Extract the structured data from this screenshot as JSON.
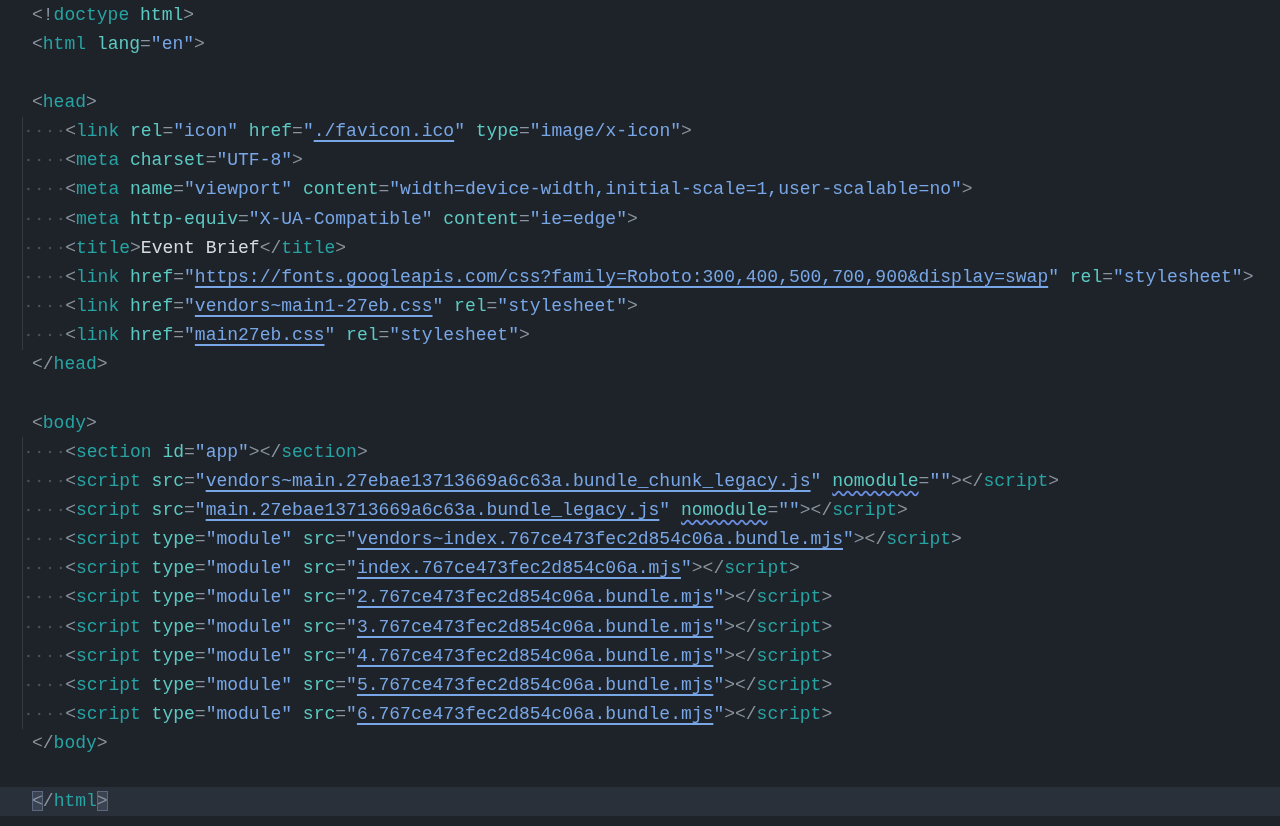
{
  "lines": [
    {
      "kind": "code",
      "indented": false,
      "current": false,
      "tokens": [
        {
          "kind": "p",
          "text": "<!"
        },
        {
          "kind": "tag",
          "text": "doctype"
        },
        {
          "kind": "attr",
          "text": " html"
        },
        {
          "kind": "p",
          "text": ">"
        }
      ]
    },
    {
      "kind": "code",
      "indented": false,
      "current": false,
      "tokens": [
        {
          "kind": "p",
          "text": "<"
        },
        {
          "kind": "tag",
          "text": "html"
        },
        {
          "kind": "attr",
          "text": " lang"
        },
        {
          "kind": "p",
          "text": "="
        },
        {
          "kind": "str",
          "text": "\"en\""
        },
        {
          "kind": "p",
          "text": ">"
        }
      ]
    },
    {
      "kind": "blank"
    },
    {
      "kind": "code",
      "indented": false,
      "current": false,
      "tokens": [
        {
          "kind": "p",
          "text": "<"
        },
        {
          "kind": "tag",
          "text": "head"
        },
        {
          "kind": "p",
          "text": ">"
        }
      ]
    },
    {
      "kind": "code",
      "indented": true,
      "current": false,
      "tokens": [
        {
          "kind": "p",
          "text": "<"
        },
        {
          "kind": "tag",
          "text": "link"
        },
        {
          "kind": "attr",
          "text": " rel"
        },
        {
          "kind": "p",
          "text": "="
        },
        {
          "kind": "str",
          "text": "\"icon\""
        },
        {
          "kind": "attr",
          "text": " href"
        },
        {
          "kind": "p",
          "text": "="
        },
        {
          "kind": "str",
          "text": "\""
        },
        {
          "kind": "link",
          "text": "./favicon.ico"
        },
        {
          "kind": "str",
          "text": "\""
        },
        {
          "kind": "attr",
          "text": " type"
        },
        {
          "kind": "p",
          "text": "="
        },
        {
          "kind": "str",
          "text": "\"image/x-icon\""
        },
        {
          "kind": "p",
          "text": ">"
        }
      ]
    },
    {
      "kind": "code",
      "indented": true,
      "current": false,
      "tokens": [
        {
          "kind": "p",
          "text": "<"
        },
        {
          "kind": "tag",
          "text": "meta"
        },
        {
          "kind": "attr",
          "text": " charset"
        },
        {
          "kind": "p",
          "text": "="
        },
        {
          "kind": "str",
          "text": "\"UTF-8\""
        },
        {
          "kind": "p",
          "text": ">"
        }
      ]
    },
    {
      "kind": "code",
      "indented": true,
      "current": false,
      "tokens": [
        {
          "kind": "p",
          "text": "<"
        },
        {
          "kind": "tag",
          "text": "meta"
        },
        {
          "kind": "attr",
          "text": " name"
        },
        {
          "kind": "p",
          "text": "="
        },
        {
          "kind": "str",
          "text": "\"viewport\""
        },
        {
          "kind": "attr",
          "text": " content"
        },
        {
          "kind": "p",
          "text": "="
        },
        {
          "kind": "str",
          "text": "\"width=device-width,initial-scale=1,user-scalable=no\""
        },
        {
          "kind": "p",
          "text": ">"
        }
      ]
    },
    {
      "kind": "code",
      "indented": true,
      "current": false,
      "tokens": [
        {
          "kind": "p",
          "text": "<"
        },
        {
          "kind": "tag",
          "text": "meta"
        },
        {
          "kind": "attr",
          "text": " http-equiv"
        },
        {
          "kind": "p",
          "text": "="
        },
        {
          "kind": "str",
          "text": "\"X-UA-Compatible\""
        },
        {
          "kind": "attr",
          "text": " content"
        },
        {
          "kind": "p",
          "text": "="
        },
        {
          "kind": "str",
          "text": "\"ie=edge\""
        },
        {
          "kind": "p",
          "text": ">"
        }
      ]
    },
    {
      "kind": "code",
      "indented": true,
      "current": false,
      "tokens": [
        {
          "kind": "p",
          "text": "<"
        },
        {
          "kind": "tag",
          "text": "title"
        },
        {
          "kind": "p",
          "text": ">"
        },
        {
          "kind": "text",
          "text": "Event Brief"
        },
        {
          "kind": "p",
          "text": "</"
        },
        {
          "kind": "tag",
          "text": "title"
        },
        {
          "kind": "p",
          "text": ">"
        }
      ]
    },
    {
      "kind": "code",
      "indented": true,
      "current": false,
      "tokens": [
        {
          "kind": "p",
          "text": "<"
        },
        {
          "kind": "tag",
          "text": "link"
        },
        {
          "kind": "attr",
          "text": " href"
        },
        {
          "kind": "p",
          "text": "="
        },
        {
          "kind": "str",
          "text": "\""
        },
        {
          "kind": "link",
          "text": "https://fonts.googleapis.com/css?family=Roboto:300,400,500,700,900&display=swap"
        },
        {
          "kind": "str",
          "text": "\""
        },
        {
          "kind": "attr",
          "text": " rel"
        },
        {
          "kind": "p",
          "text": "="
        },
        {
          "kind": "str",
          "text": "\"stylesheet\""
        },
        {
          "kind": "p",
          "text": ">"
        }
      ]
    },
    {
      "kind": "code",
      "indented": true,
      "current": false,
      "tokens": [
        {
          "kind": "p",
          "text": "<"
        },
        {
          "kind": "tag",
          "text": "link"
        },
        {
          "kind": "attr",
          "text": " href"
        },
        {
          "kind": "p",
          "text": "="
        },
        {
          "kind": "str",
          "text": "\""
        },
        {
          "kind": "link",
          "text": "vendors~main1-27eb.css"
        },
        {
          "kind": "str",
          "text": "\""
        },
        {
          "kind": "attr",
          "text": " rel"
        },
        {
          "kind": "p",
          "text": "="
        },
        {
          "kind": "str",
          "text": "\"stylesheet\""
        },
        {
          "kind": "p",
          "text": ">"
        }
      ]
    },
    {
      "kind": "code",
      "indented": true,
      "current": false,
      "tokens": [
        {
          "kind": "p",
          "text": "<"
        },
        {
          "kind": "tag",
          "text": "link"
        },
        {
          "kind": "attr",
          "text": " href"
        },
        {
          "kind": "p",
          "text": "="
        },
        {
          "kind": "str",
          "text": "\""
        },
        {
          "kind": "link",
          "text": "main27eb.css"
        },
        {
          "kind": "str",
          "text": "\""
        },
        {
          "kind": "attr",
          "text": " rel"
        },
        {
          "kind": "p",
          "text": "="
        },
        {
          "kind": "str",
          "text": "\"stylesheet\""
        },
        {
          "kind": "p",
          "text": ">"
        }
      ]
    },
    {
      "kind": "code",
      "indented": false,
      "current": false,
      "tokens": [
        {
          "kind": "p",
          "text": "</"
        },
        {
          "kind": "tag",
          "text": "head"
        },
        {
          "kind": "p",
          "text": ">"
        }
      ]
    },
    {
      "kind": "blank"
    },
    {
      "kind": "code",
      "indented": false,
      "current": false,
      "tokens": [
        {
          "kind": "p",
          "text": "<"
        },
        {
          "kind": "tag",
          "text": "body"
        },
        {
          "kind": "p",
          "text": ">"
        }
      ]
    },
    {
      "kind": "code",
      "indented": true,
      "current": false,
      "tokens": [
        {
          "kind": "p",
          "text": "<"
        },
        {
          "kind": "tag",
          "text": "section"
        },
        {
          "kind": "attr",
          "text": " id"
        },
        {
          "kind": "p",
          "text": "="
        },
        {
          "kind": "str",
          "text": "\"app\""
        },
        {
          "kind": "p",
          "text": "></"
        },
        {
          "kind": "tag",
          "text": "section"
        },
        {
          "kind": "p",
          "text": ">"
        }
      ]
    },
    {
      "kind": "code",
      "indented": true,
      "current": false,
      "tokens": [
        {
          "kind": "p",
          "text": "<"
        },
        {
          "kind": "tag",
          "text": "script"
        },
        {
          "kind": "attr",
          "text": " src"
        },
        {
          "kind": "p",
          "text": "="
        },
        {
          "kind": "str",
          "text": "\""
        },
        {
          "kind": "link",
          "text": "vendors~main.27ebae13713669a6c63a.bundle_chunk_legacy.js"
        },
        {
          "kind": "str",
          "text": "\" "
        },
        {
          "kind": "wavy",
          "text": "nomodule"
        },
        {
          "kind": "p",
          "text": "="
        },
        {
          "kind": "str",
          "text": "\"\""
        },
        {
          "kind": "p",
          "text": "></"
        },
        {
          "kind": "tag",
          "text": "script"
        },
        {
          "kind": "p",
          "text": ">"
        }
      ]
    },
    {
      "kind": "code",
      "indented": true,
      "current": false,
      "tokens": [
        {
          "kind": "p",
          "text": "<"
        },
        {
          "kind": "tag",
          "text": "script"
        },
        {
          "kind": "attr",
          "text": " src"
        },
        {
          "kind": "p",
          "text": "="
        },
        {
          "kind": "str",
          "text": "\""
        },
        {
          "kind": "link",
          "text": "main.27ebae13713669a6c63a.bundle_legacy.js"
        },
        {
          "kind": "str",
          "text": "\" "
        },
        {
          "kind": "wavy",
          "text": "nomodule"
        },
        {
          "kind": "p",
          "text": "="
        },
        {
          "kind": "str",
          "text": "\"\""
        },
        {
          "kind": "p",
          "text": "></"
        },
        {
          "kind": "tag",
          "text": "script"
        },
        {
          "kind": "p",
          "text": ">"
        }
      ]
    },
    {
      "kind": "code",
      "indented": true,
      "current": false,
      "tokens": [
        {
          "kind": "p",
          "text": "<"
        },
        {
          "kind": "tag",
          "text": "script"
        },
        {
          "kind": "attr",
          "text": " type"
        },
        {
          "kind": "p",
          "text": "="
        },
        {
          "kind": "str",
          "text": "\"module\""
        },
        {
          "kind": "attr",
          "text": " src"
        },
        {
          "kind": "p",
          "text": "="
        },
        {
          "kind": "str",
          "text": "\""
        },
        {
          "kind": "link",
          "text": "vendors~index.767ce473fec2d854c06a.bundle.mjs"
        },
        {
          "kind": "str",
          "text": "\""
        },
        {
          "kind": "p",
          "text": "></"
        },
        {
          "kind": "tag",
          "text": "script"
        },
        {
          "kind": "p",
          "text": ">"
        }
      ]
    },
    {
      "kind": "code",
      "indented": true,
      "current": false,
      "tokens": [
        {
          "kind": "p",
          "text": "<"
        },
        {
          "kind": "tag",
          "text": "script"
        },
        {
          "kind": "attr",
          "text": " type"
        },
        {
          "kind": "p",
          "text": "="
        },
        {
          "kind": "str",
          "text": "\"module\""
        },
        {
          "kind": "attr",
          "text": " src"
        },
        {
          "kind": "p",
          "text": "="
        },
        {
          "kind": "str",
          "text": "\""
        },
        {
          "kind": "link",
          "text": "index.767ce473fec2d854c06a.mjs"
        },
        {
          "kind": "str",
          "text": "\""
        },
        {
          "kind": "p",
          "text": "></"
        },
        {
          "kind": "tag",
          "text": "script"
        },
        {
          "kind": "p",
          "text": ">"
        }
      ]
    },
    {
      "kind": "code",
      "indented": true,
      "current": false,
      "tokens": [
        {
          "kind": "p",
          "text": "<"
        },
        {
          "kind": "tag",
          "text": "script"
        },
        {
          "kind": "attr",
          "text": " type"
        },
        {
          "kind": "p",
          "text": "="
        },
        {
          "kind": "str",
          "text": "\"module\""
        },
        {
          "kind": "attr",
          "text": " src"
        },
        {
          "kind": "p",
          "text": "="
        },
        {
          "kind": "str",
          "text": "\""
        },
        {
          "kind": "link",
          "text": "2.767ce473fec2d854c06a.bundle.mjs"
        },
        {
          "kind": "str",
          "text": "\""
        },
        {
          "kind": "p",
          "text": "></"
        },
        {
          "kind": "tag",
          "text": "script"
        },
        {
          "kind": "p",
          "text": ">"
        }
      ]
    },
    {
      "kind": "code",
      "indented": true,
      "current": false,
      "tokens": [
        {
          "kind": "p",
          "text": "<"
        },
        {
          "kind": "tag",
          "text": "script"
        },
        {
          "kind": "attr",
          "text": " type"
        },
        {
          "kind": "p",
          "text": "="
        },
        {
          "kind": "str",
          "text": "\"module\""
        },
        {
          "kind": "attr",
          "text": " src"
        },
        {
          "kind": "p",
          "text": "="
        },
        {
          "kind": "str",
          "text": "\""
        },
        {
          "kind": "link",
          "text": "3.767ce473fec2d854c06a.bundle.mjs"
        },
        {
          "kind": "str",
          "text": "\""
        },
        {
          "kind": "p",
          "text": "></"
        },
        {
          "kind": "tag",
          "text": "script"
        },
        {
          "kind": "p",
          "text": ">"
        }
      ]
    },
    {
      "kind": "code",
      "indented": true,
      "current": false,
      "tokens": [
        {
          "kind": "p",
          "text": "<"
        },
        {
          "kind": "tag",
          "text": "script"
        },
        {
          "kind": "attr",
          "text": " type"
        },
        {
          "kind": "p",
          "text": "="
        },
        {
          "kind": "str",
          "text": "\"module\""
        },
        {
          "kind": "attr",
          "text": " src"
        },
        {
          "kind": "p",
          "text": "="
        },
        {
          "kind": "str",
          "text": "\""
        },
        {
          "kind": "link",
          "text": "4.767ce473fec2d854c06a.bundle.mjs"
        },
        {
          "kind": "str",
          "text": "\""
        },
        {
          "kind": "p",
          "text": "></"
        },
        {
          "kind": "tag",
          "text": "script"
        },
        {
          "kind": "p",
          "text": ">"
        }
      ]
    },
    {
      "kind": "code",
      "indented": true,
      "current": false,
      "tokens": [
        {
          "kind": "p",
          "text": "<"
        },
        {
          "kind": "tag",
          "text": "script"
        },
        {
          "kind": "attr",
          "text": " type"
        },
        {
          "kind": "p",
          "text": "="
        },
        {
          "kind": "str",
          "text": "\"module\""
        },
        {
          "kind": "attr",
          "text": " src"
        },
        {
          "kind": "p",
          "text": "="
        },
        {
          "kind": "str",
          "text": "\""
        },
        {
          "kind": "link",
          "text": "5.767ce473fec2d854c06a.bundle.mjs"
        },
        {
          "kind": "str",
          "text": "\""
        },
        {
          "kind": "p",
          "text": "></"
        },
        {
          "kind": "tag",
          "text": "script"
        },
        {
          "kind": "p",
          "text": ">"
        }
      ]
    },
    {
      "kind": "code",
      "indented": true,
      "current": false,
      "tokens": [
        {
          "kind": "p",
          "text": "<"
        },
        {
          "kind": "tag",
          "text": "script"
        },
        {
          "kind": "attr",
          "text": " type"
        },
        {
          "kind": "p",
          "text": "="
        },
        {
          "kind": "str",
          "text": "\"module\""
        },
        {
          "kind": "attr",
          "text": " src"
        },
        {
          "kind": "p",
          "text": "="
        },
        {
          "kind": "str",
          "text": "\""
        },
        {
          "kind": "link",
          "text": "6.767ce473fec2d854c06a.bundle.mjs"
        },
        {
          "kind": "str",
          "text": "\""
        },
        {
          "kind": "p",
          "text": "></"
        },
        {
          "kind": "tag",
          "text": "script"
        },
        {
          "kind": "p",
          "text": ">"
        }
      ]
    },
    {
      "kind": "code",
      "indented": false,
      "current": false,
      "tokens": [
        {
          "kind": "p",
          "text": "</"
        },
        {
          "kind": "tag",
          "text": "body"
        },
        {
          "kind": "p",
          "text": ">"
        }
      ]
    },
    {
      "kind": "blank"
    },
    {
      "kind": "code",
      "indented": false,
      "current": true,
      "tokens": [
        {
          "kind": "match",
          "text": "<"
        },
        {
          "kind": "p",
          "text": "/"
        },
        {
          "kind": "tag",
          "text": "html"
        },
        {
          "kind": "match",
          "text": ">"
        }
      ]
    }
  ]
}
